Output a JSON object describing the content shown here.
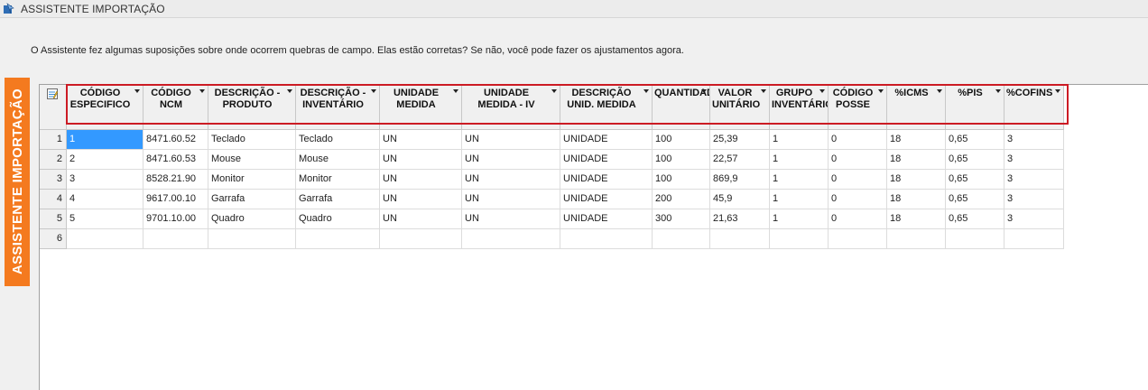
{
  "window": {
    "title": "ASSISTENTE IMPORTAÇÃO"
  },
  "message": "O Assistente fez algumas suposições sobre onde ocorrem quebras de campo. Elas estão corretas? Se não, você pode fazer os ajustamentos agora.",
  "side_tab": {
    "label": "ASSISTENTE IMPORTAÇÃO"
  },
  "colors": {
    "accent": "#f47a1f",
    "highlight": "#cc1b24",
    "selection": "#3399ff"
  },
  "grid": {
    "columns": [
      {
        "label": "CÓDIGO\nESPECIFICO"
      },
      {
        "label": "CÓDIGO\nNCM"
      },
      {
        "label": "DESCRIÇÃO -\nPRODUTO"
      },
      {
        "label": "DESCRIÇÃO -\nINVENTÁRIO"
      },
      {
        "label": "UNIDADE\nMEDIDA"
      },
      {
        "label": "UNIDADE\nMEDIDA - IV"
      },
      {
        "label": "DESCRIÇÃO\nUNID. MEDIDA"
      },
      {
        "label": "QUANTIDADE"
      },
      {
        "label": "VALOR\nUNITÁRIO"
      },
      {
        "label": "GRUPO\nINVENTÁRIO"
      },
      {
        "label": "CÓDIGO\nPOSSE"
      },
      {
        "label": "%ICMS"
      },
      {
        "label": "%PIS"
      },
      {
        "label": "%COFINS"
      }
    ],
    "rows": [
      {
        "num": "1",
        "cells": [
          "1",
          "8471.60.52",
          "Teclado",
          "Teclado",
          "UN",
          "UN",
          "UNIDADE",
          "100",
          "25,39",
          "1",
          "0",
          "18",
          "0,65",
          "3"
        ]
      },
      {
        "num": "2",
        "cells": [
          "2",
          "8471.60.53",
          "Mouse",
          "Mouse",
          "UN",
          "UN",
          "UNIDADE",
          "100",
          "22,57",
          "1",
          "0",
          "18",
          "0,65",
          "3"
        ]
      },
      {
        "num": "3",
        "cells": [
          "3",
          "8528.21.90",
          "Monitor",
          "Monitor",
          "UN",
          "UN",
          "UNIDADE",
          "100",
          "869,9",
          "1",
          "0",
          "18",
          "0,65",
          "3"
        ]
      },
      {
        "num": "4",
        "cells": [
          "4",
          "9617.00.10",
          "Garrafa",
          "Garrafa",
          "UN",
          "UN",
          "UNIDADE",
          "200",
          "45,9",
          "1",
          "0",
          "18",
          "0,65",
          "3"
        ]
      },
      {
        "num": "5",
        "cells": [
          "5",
          "9701.10.00",
          "Quadro",
          "Quadro",
          "UN",
          "UN",
          "UNIDADE",
          "300",
          "21,63",
          "1",
          "0",
          "18",
          "0,65",
          "3"
        ]
      },
      {
        "num": "6",
        "cells": [
          "",
          "",
          "",
          "",
          "",
          "",
          "",
          "",
          "",
          "",
          "",
          "",
          "",
          ""
        ]
      }
    ]
  }
}
